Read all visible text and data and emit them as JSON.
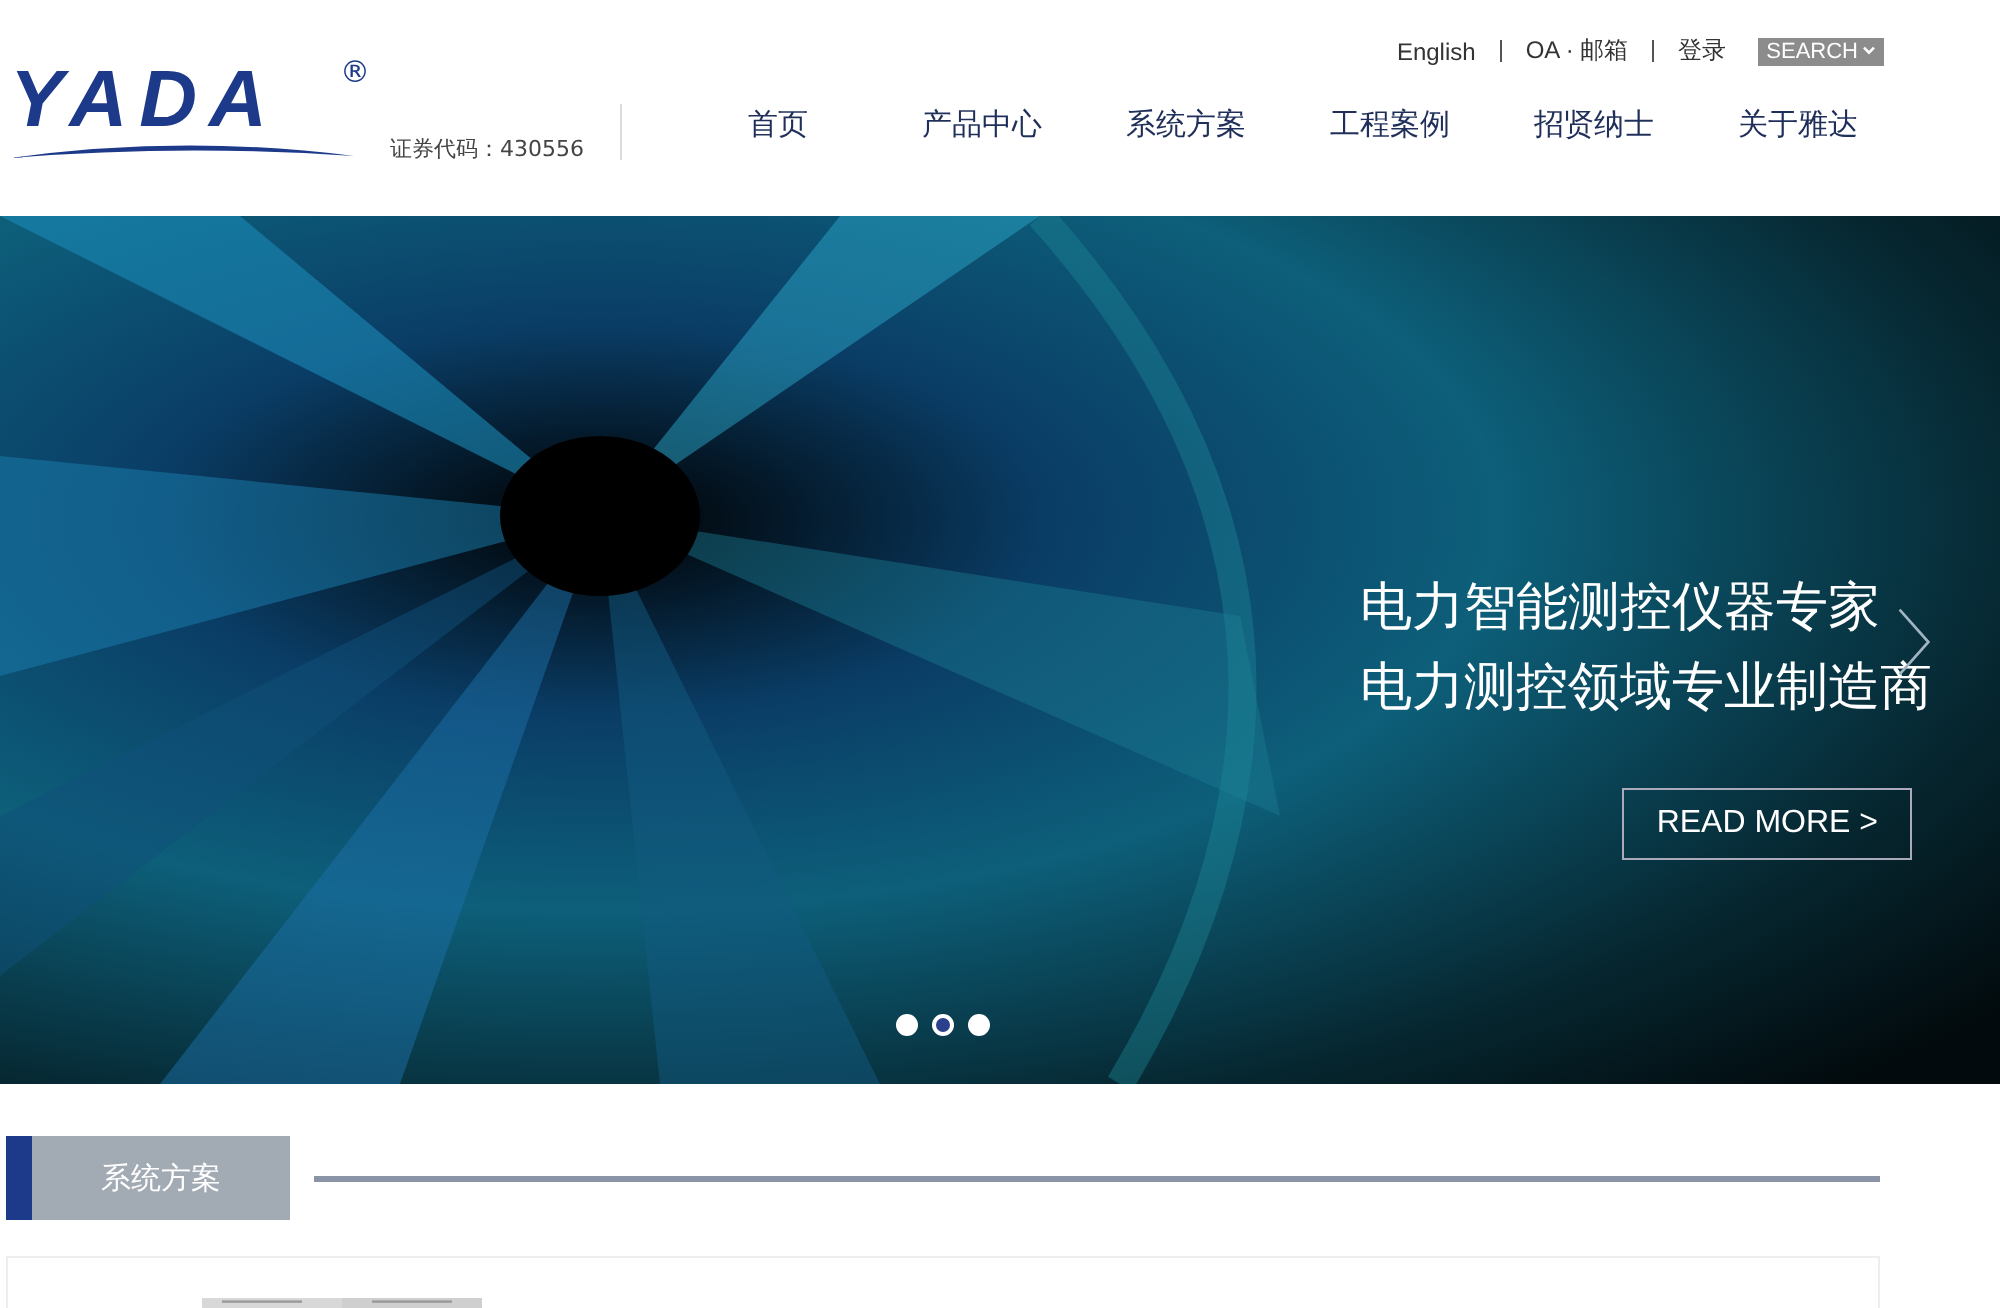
{
  "header": {
    "logo": "YADA",
    "logo_mark": "®",
    "stock_code": "证券代码：430556",
    "top_links": [
      {
        "label": "English"
      },
      {
        "label": "OA · 邮箱"
      },
      {
        "label": "登录"
      }
    ],
    "search_button": "SEARCH",
    "nav": [
      {
        "label": "首页"
      },
      {
        "label": "产品中心"
      },
      {
        "label": "系统方案"
      },
      {
        "label": "工程案例"
      },
      {
        "label": "招贤纳士"
      },
      {
        "label": "关于雅达"
      }
    ]
  },
  "banner": {
    "headlines": [
      "电力智能测控仪器专家",
      "电力测控领域专业制造商"
    ],
    "button": "READ MORE >",
    "dots": [
      {
        "selected": false
      },
      {
        "selected": true
      },
      {
        "selected": false
      }
    ]
  },
  "section": {
    "title": "系统方案"
  }
}
